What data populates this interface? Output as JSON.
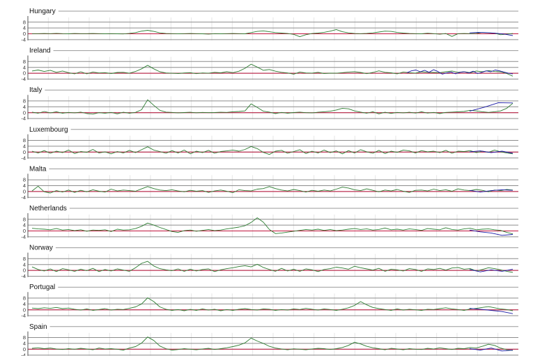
{
  "chart_data": [
    {
      "type": "line",
      "title": "Hungary",
      "yticks": [
        8,
        4,
        0,
        -4
      ],
      "reference_line": 0,
      "series": [
        {
          "color": "#2e7d32",
          "values": [
            0.1,
            0.1,
            0.2,
            0.1,
            0.3,
            0.1,
            0.0,
            0.2,
            0.1,
            0.1,
            0.2,
            0.1,
            0.0,
            0.1,
            0.0,
            -0.1,
            0.3,
            0.8,
            1.8,
            2.4,
            1.6,
            0.6,
            0.2,
            0.1,
            0.0,
            0.1,
            0.2,
            0.1,
            0.0,
            -0.2,
            0.1,
            0.0,
            0.1,
            0.2,
            0.1,
            0.0,
            0.8,
            1.6,
            2.0,
            1.4,
            0.8,
            0.5,
            0.2,
            -0.4,
            -2.0,
            -0.6,
            0.2,
            0.5,
            1.0,
            1.8,
            2.9,
            1.4,
            0.6,
            0.2,
            0.1,
            0.3,
            0.6,
            1.2,
            1.8,
            1.6,
            0.9,
            0.5,
            0.2,
            0.1,
            0.0,
            0.4,
            0.1,
            -0.3,
            0.2,
            -1.8,
            0.1,
            0.2,
            0.1,
            0.3,
            0.9,
            0.6,
            0.4,
            -0.6,
            -0.2,
            0.2
          ]
        },
        {
          "color": "#1a1aa6",
          "values": [
            0.6,
            1.0,
            0.8,
            0.4,
            -0.2,
            -1.2
          ]
        }
      ]
    },
    {
      "type": "line",
      "title": "Ireland",
      "yticks": [
        8,
        4,
        0,
        -4
      ],
      "reference_line": 0,
      "series": [
        {
          "color": "#2e7d32",
          "values": [
            1.5,
            2.2,
            1.2,
            2.0,
            0.6,
            1.5,
            0.4,
            -0.4,
            1.0,
            -0.4,
            0.8,
            0.2,
            0.4,
            -0.2,
            0.5,
            0.6,
            0.0,
            1.2,
            3.0,
            5.4,
            3.0,
            1.0,
            0.2,
            0.0,
            -0.2,
            0.2,
            0.4,
            -0.3,
            0.2,
            0.0,
            0.6,
            0.3,
            1.0,
            0.4,
            1.4,
            3.4,
            6.2,
            4.2,
            2.0,
            2.5,
            1.4,
            0.6,
            0.2,
            -0.6,
            0.8,
            0.2,
            0.1,
            0.6,
            -0.2,
            0.1,
            0.0,
            0.4,
            0.8,
            1.0,
            0.5,
            -0.3,
            0.5,
            1.6,
            0.6,
            0.3,
            -0.4,
            0.8,
            0.4,
            0.1,
            1.0,
            0.6,
            0.5,
            0.4,
            1.0,
            1.5,
            0.6,
            1.0,
            0.4,
            1.5,
            1.0,
            1.8,
            1.2,
            1.0,
            -0.2,
            -2.0
          ]
        },
        {
          "color": "#1a1aa6",
          "values": [
            0.4,
            1.6,
            2.2,
            1.0,
            2.0,
            0.6,
            2.4,
            1.2,
            -0.6,
            0.2,
            0.8,
            -0.4,
            0.6,
            1.0,
            0.2,
            1.4,
            -0.2,
            0.6,
            1.6,
            1.0,
            2.2,
            1.6,
            0.8,
            0.0,
            -0.5
          ]
        }
      ]
    },
    {
      "type": "line",
      "title": "Italy",
      "yticks": [
        8,
        4,
        0,
        -4
      ],
      "reference_line": 0,
      "series": [
        {
          "color": "#2e7d32",
          "values": [
            0.4,
            -0.4,
            0.8,
            -0.2,
            0.6,
            -0.4,
            0.2,
            -0.2,
            0.4,
            -0.6,
            -1.0,
            0.0,
            -0.4,
            0.2,
            -0.8,
            0.3,
            -0.4,
            0.2,
            2.0,
            8.8,
            5.0,
            1.6,
            0.4,
            0.2,
            -0.2,
            0.1,
            0.3,
            -0.1,
            0.2,
            0.0,
            0.1,
            0.3,
            0.2,
            0.6,
            0.8,
            1.2,
            6.0,
            3.6,
            1.0,
            0.4,
            -0.6,
            0.2,
            -0.4,
            0.1,
            0.4,
            0.0,
            -0.2,
            0.3,
            0.6,
            1.0,
            1.8,
            3.0,
            2.6,
            1.2,
            0.4,
            -0.4,
            0.6,
            -0.8,
            0.3,
            -0.5,
            0.2,
            -0.2,
            0.3,
            -0.3,
            0.6,
            -0.3,
            0.2,
            -0.6,
            0.2,
            0.4,
            0.6,
            0.8,
            1.6,
            1.2,
            0.6,
            0.2,
            0.6,
            1.2,
            3.0,
            6.4
          ]
        },
        {
          "color": "#1a1aa6",
          "values": [
            1.0,
            3.6,
            6.8,
            6.6
          ]
        }
      ]
    },
    {
      "type": "line",
      "title": "Luxembourg",
      "yticks": [
        8,
        4,
        0,
        -4
      ],
      "reference_line": 0,
      "series": [
        {
          "color": "#2e7d32",
          "values": [
            0.6,
            -0.6,
            1.0,
            -0.8,
            0.6,
            -0.4,
            1.4,
            -1.0,
            0.4,
            -0.2,
            1.8,
            -0.6,
            0.2,
            -1.2,
            0.4,
            -0.6,
            1.2,
            -0.4,
            1.6,
            3.6,
            1.4,
            0.4,
            -0.8,
            1.0,
            -0.6,
            1.4,
            -1.2,
            0.6,
            -0.4,
            1.2,
            -0.8,
            0.4,
            0.8,
            1.4,
            0.6,
            1.8,
            3.8,
            2.4,
            -0.2,
            -1.6,
            0.6,
            1.2,
            -0.8,
            0.4,
            1.6,
            -1.0,
            0.6,
            -0.6,
            1.4,
            -0.4,
            0.8,
            -1.2,
            1.0,
            -0.6,
            1.6,
            0.2,
            -0.8,
            1.2,
            -1.0,
            0.6,
            -0.2,
            1.4,
            0.8,
            -0.6,
            1.0,
            0.2,
            0.6,
            -0.4,
            1.2,
            -0.8,
            0.6,
            0.4,
            1.0,
            -0.4,
            0.6,
            -0.2,
            1.4,
            0.2,
            -0.6,
            -1.2
          ]
        },
        {
          "color": "#1a1aa6",
          "values": [
            0.2,
            0.8,
            -0.4,
            0.6,
            -0.8
          ]
        }
      ]
    },
    {
      "type": "line",
      "title": "Malta",
      "yticks": [
        8,
        4,
        0,
        -4
      ],
      "reference_line": 0,
      "series": [
        {
          "color": "#2e7d32",
          "values": [
            0.4,
            3.6,
            -0.2,
            -1.0,
            0.6,
            -0.4,
            1.0,
            -0.6,
            0.8,
            -0.2,
            1.2,
            0.2,
            -0.4,
            1.6,
            0.4,
            1.0,
            0.6,
            0.2,
            1.8,
            3.4,
            2.0,
            1.0,
            0.6,
            1.2,
            0.4,
            -0.2,
            0.8,
            0.2,
            0.6,
            -0.6,
            0.4,
            1.0,
            0.2,
            -0.8,
            1.2,
            0.6,
            0.4,
            1.6,
            2.0,
            3.4,
            2.0,
            1.0,
            0.4,
            1.4,
            0.6,
            -0.4,
            0.8,
            0.2,
            1.0,
            0.4,
            1.6,
            3.0,
            2.4,
            1.2,
            0.6,
            1.8,
            0.8,
            -0.2,
            1.0,
            0.4,
            1.4,
            0.2,
            -0.6,
            0.8,
            1.0,
            0.4,
            1.6,
            0.6,
            1.2,
            0.2,
            1.8,
            1.0,
            0.6,
            1.4,
            0.8,
            -0.2,
            1.0,
            0.6,
            1.4,
            1.0
          ]
        },
        {
          "color": "#1a1aa6",
          "values": [
            0.8,
            -0.4,
            0.6,
            1.2,
            0.8
          ]
        }
      ]
    },
    {
      "type": "line",
      "title": "Netherlands",
      "yticks": [
        8,
        4,
        0,
        -4
      ],
      "reference_line": 0,
      "series": [
        {
          "color": "#2e7d32",
          "values": [
            1.8,
            1.4,
            1.2,
            0.8,
            1.6,
            0.6,
            1.0,
            0.2,
            0.8,
            -0.2,
            0.6,
            0.4,
            0.8,
            -0.4,
            1.2,
            0.6,
            0.8,
            1.6,
            3.2,
            5.4,
            4.0,
            2.4,
            1.0,
            -0.4,
            -1.0,
            0.2,
            0.6,
            -0.2,
            0.4,
            1.0,
            0.2,
            0.6,
            1.4,
            2.0,
            2.6,
            3.6,
            5.8,
            9.0,
            6.0,
            1.0,
            -1.8,
            -1.4,
            -0.8,
            -0.2,
            0.4,
            1.0,
            0.6,
            1.2,
            0.4,
            1.0,
            0.2,
            0.6,
            1.2,
            1.6,
            1.0,
            1.4,
            0.6,
            1.0,
            2.0,
            0.8,
            1.2,
            0.6,
            1.4,
            1.0,
            0.4,
            1.6,
            1.2,
            0.8,
            2.2,
            1.0,
            0.6,
            1.4,
            1.8,
            0.8,
            1.2,
            1.4,
            0.8,
            0.4,
            -1.0,
            -2.0
          ]
        },
        {
          "color": "#1a1aa6",
          "values": [
            0.6,
            -0.6,
            -1.4,
            -3.0,
            -2.4
          ]
        }
      ]
    },
    {
      "type": "line",
      "title": "Norway",
      "yticks": [
        8,
        4,
        0,
        -4
      ],
      "reference_line": 0,
      "series": [
        {
          "color": "#2e7d32",
          "values": [
            2.4,
            0.6,
            -0.4,
            1.0,
            -0.8,
            1.2,
            0.4,
            -0.6,
            0.8,
            -0.2,
            1.4,
            -0.8,
            0.6,
            -0.4,
            1.0,
            0.2,
            -0.6,
            1.8,
            4.8,
            6.2,
            3.0,
            1.2,
            0.4,
            -0.2,
            1.0,
            -0.6,
            0.8,
            -0.4,
            0.6,
            1.0,
            -0.8,
            0.4,
            1.2,
            1.8,
            2.6,
            3.2,
            2.4,
            4.2,
            2.0,
            0.6,
            -0.6,
            1.4,
            -0.4,
            0.8,
            -0.6,
            1.0,
            0.4,
            -0.8,
            0.6,
            1.2,
            2.2,
            1.6,
            0.8,
            2.8,
            1.8,
            1.0,
            0.2,
            1.4,
            -0.6,
            0.8,
            0.4,
            -0.4,
            1.2,
            0.6,
            -0.6,
            1.0,
            0.6,
            1.4,
            0.2,
            1.6,
            2.0,
            0.8,
            1.2,
            -0.4,
            0.6,
            1.8,
            1.2,
            0.4,
            -0.6,
            -1.4
          ]
        },
        {
          "color": "#1a1aa6",
          "values": [
            0.6,
            -1.0,
            0.4,
            -0.6,
            0.8
          ]
        }
      ]
    },
    {
      "type": "line",
      "title": "Portugal",
      "yticks": [
        8,
        4,
        0,
        -4
      ],
      "reference_line": 0,
      "series": [
        {
          "color": "#2e7d32",
          "values": [
            1.2,
            0.8,
            1.4,
            1.0,
            1.6,
            0.8,
            1.2,
            0.4,
            -0.2,
            0.6,
            -0.4,
            0.2,
            0.8,
            -0.2,
            0.4,
            0.2,
            1.0,
            2.0,
            4.0,
            8.2,
            5.6,
            2.0,
            0.4,
            -0.4,
            0.2,
            -0.6,
            0.3,
            -0.4,
            0.6,
            -0.2,
            0.4,
            -0.6,
            0.2,
            -0.4,
            0.4,
            0.8,
            0.2,
            -0.2,
            0.6,
            0.4,
            -0.4,
            0.2,
            -0.2,
            0.6,
            0.2,
            1.0,
            0.4,
            -0.2,
            0.6,
            0.2,
            -0.4,
            0.4,
            1.4,
            3.0,
            5.6,
            3.4,
            1.6,
            0.8,
            0.2,
            -0.4,
            0.6,
            -0.2,
            0.4,
            0.0,
            -0.4,
            0.4,
            0.2,
            0.8,
            1.4,
            0.6,
            0.2,
            -0.4,
            0.6,
            1.0,
            1.6,
            2.2,
            1.4,
            0.6,
            0.2,
            -0.6
          ]
        },
        {
          "color": "#1a1aa6",
          "values": [
            1.0,
            0.4,
            -0.4,
            -1.2,
            -2.6
          ]
        }
      ]
    },
    {
      "type": "line",
      "title": "Spain",
      "yticks": [
        8,
        4,
        0,
        -4
      ],
      "reference_line": 0,
      "series": [
        {
          "color": "#2e7d32",
          "values": [
            0.6,
            1.0,
            0.4,
            0.8,
            0.2,
            -0.2,
            0.4,
            0.0,
            0.6,
            0.2,
            -0.4,
            0.8,
            0.2,
            0.4,
            0.0,
            -0.6,
            0.8,
            1.8,
            4.2,
            8.4,
            6.0,
            2.2,
            0.4,
            -0.6,
            -0.2,
            0.4,
            0.0,
            -0.4,
            0.2,
            0.6,
            -0.2,
            0.4,
            1.0,
            1.8,
            2.8,
            4.4,
            7.6,
            5.6,
            4.0,
            2.0,
            0.8,
            0.2,
            -0.4,
            0.3,
            0.0,
            -0.4,
            0.2,
            0.6,
            0.4,
            -0.2,
            0.4,
            1.2,
            2.6,
            4.8,
            3.6,
            2.0,
            1.0,
            0.4,
            -0.4,
            0.6,
            0.2,
            -0.4,
            0.4,
            0.0,
            -0.2,
            0.6,
            0.2,
            1.0,
            0.4,
            -0.2,
            0.6,
            0.4,
            1.2,
            0.8,
            2.0,
            3.4,
            2.6,
            0.8,
            -0.4,
            -0.8
          ]
        },
        {
          "color": "#1a1aa6",
          "values": [
            0.4,
            -0.6,
            0.8,
            -1.2,
            -0.6
          ]
        }
      ]
    }
  ]
}
